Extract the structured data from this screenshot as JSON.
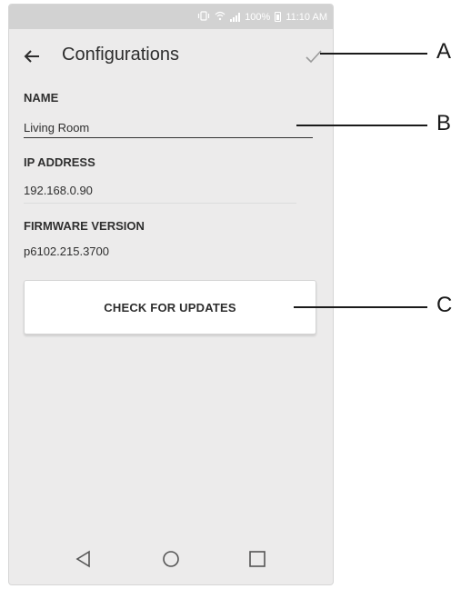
{
  "status_bar": {
    "battery_text": "100%",
    "time": "11:10 AM",
    "icons": [
      "vibrate-icon",
      "wifi-icon",
      "signal-icon",
      "battery-icon"
    ]
  },
  "app_bar": {
    "title": "Configurations",
    "back_icon": "arrow-left-icon",
    "confirm_icon": "check-icon"
  },
  "fields": {
    "name_label": "NAME",
    "name_value": "Living Room",
    "ip_label": "IP ADDRESS",
    "ip_value": "192.168.0.90",
    "firmware_label": "FIRMWARE VERSION",
    "firmware_value": "p6102.215.3700"
  },
  "update_button": {
    "label": "CHECK FOR UPDATES"
  },
  "nav_bar": {
    "icons": [
      "back-triangle-icon",
      "home-circle-icon",
      "recents-square-icon"
    ]
  },
  "callouts": {
    "a": "A",
    "b": "B",
    "c": "C"
  },
  "colors": {
    "screen_background": "#ecebeb",
    "status_bar": "#d2d2d2",
    "text": "#2f2f2f",
    "button_background": "#ffffff"
  }
}
